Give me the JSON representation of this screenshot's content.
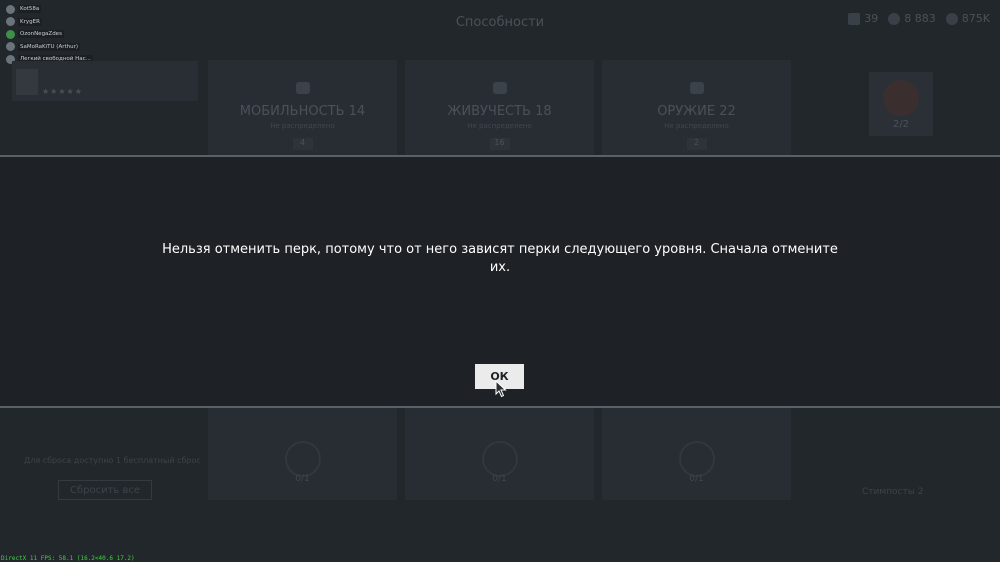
{
  "screen": {
    "title": "Способности"
  },
  "currencies": [
    {
      "value": "39",
      "icon": "token-icon"
    },
    {
      "value": "8 883",
      "icon": "coin-icon"
    },
    {
      "value": "875K",
      "icon": "credit-icon"
    }
  ],
  "party": [
    {
      "name": "Kot58a"
    },
    {
      "name": "KrygER"
    },
    {
      "name": "OzonNegaZdes"
    },
    {
      "name": "SaMoRaKiTU (Arthur)"
    },
    {
      "name": "Легкий свободной Нас..."
    }
  ],
  "skill_cards": [
    {
      "title": "МОБИЛЬНОСТЬ 14",
      "sub": "Не распределено",
      "num": "4"
    },
    {
      "title": "ЖИВУЧЕСТЬ 18",
      "sub": "Не распределено",
      "num": "16"
    },
    {
      "title": "ОРУЖИЕ 22",
      "sub": "Не распределено",
      "num": "2"
    }
  ],
  "helmet": {
    "value": "2/2"
  },
  "bottom_cards": [
    {
      "value": "0/1"
    },
    {
      "value": "0/1"
    },
    {
      "value": "0/1"
    }
  ],
  "points_note": "Для сброса доступно 1 бесплатный сброс",
  "reset_label": "Сбросить все",
  "skills_count": "Стимпосты 2",
  "fps_text": "DirectX 11 FPS: 58.1 (16.2<40.6 17.2)",
  "modal": {
    "message": "Нельзя отменить перк, потому что от него зависят перки следующего уровня. Сначала отмените их.",
    "ok_label": "ОК"
  }
}
